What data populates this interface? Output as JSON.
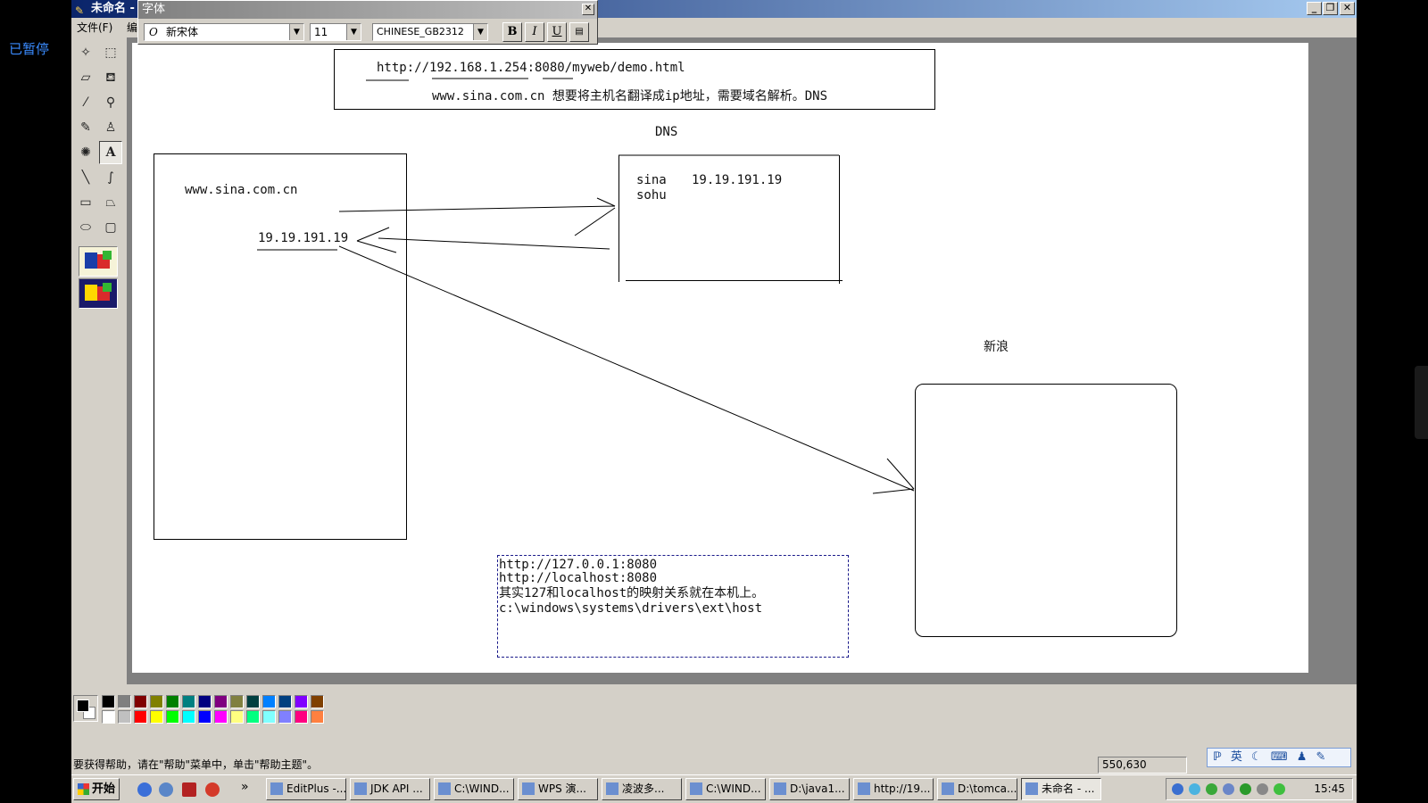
{
  "overlay": {
    "paused_label": "已暂停"
  },
  "window": {
    "title": "未命名 -",
    "min": "_",
    "max": "❐",
    "close": "✕"
  },
  "menu": {
    "file": "文件(F)",
    "edit": "编"
  },
  "font_toolbar": {
    "title": "字体",
    "close": "✕",
    "font_name": "新宋体",
    "font_size": "11",
    "charset": "CHINESE_GB2312",
    "bold": "B",
    "italic": "I",
    "underline": "U"
  },
  "tools": [
    "free-select",
    "rect-select",
    "eraser",
    "fill-bucket",
    "color-picker",
    "magnifier",
    "pencil",
    "brush",
    "airbrush",
    "text",
    "line",
    "curve",
    "rectangle",
    "polygon",
    "ellipse",
    "rounded-rectangle"
  ],
  "canvas": {
    "top_box": {
      "line1": "http://192.168.1.254:8080/myweb/demo.html",
      "line2": "www.sina.com.cn 想要将主机名翻译成ip地址，需要域名解析。DNS"
    },
    "dns_label": "DNS",
    "dns_box": {
      "row1_name": "sina",
      "row1_ip": "19.19.191.19",
      "row2_name": "sohu"
    },
    "client_box": {
      "domain": "www.sina.com.cn",
      "ip": "19.19.191.19"
    },
    "sina_label": "新浪",
    "text_box": {
      "line1": "http://127.0.0.1:8080",
      "line2": "http://localhost:8080",
      "line3": "其实127和localhost的映射关系就在本机上。",
      "line4": "c:\\windows\\systems\\drivers\\ext\\host"
    }
  },
  "palette": {
    "foreground": "#000000",
    "background": "#ffffff",
    "colors_top": [
      "#000000",
      "#808080",
      "#800000",
      "#808000",
      "#008000",
      "#008080",
      "#000080",
      "#800080",
      "#808040",
      "#004040",
      "#0080ff",
      "#004080",
      "#8000ff",
      "#804000"
    ],
    "colors_bottom": [
      "#ffffff",
      "#c0c0c0",
      "#ff0000",
      "#ffff00",
      "#00ff00",
      "#00ffff",
      "#0000ff",
      "#ff00ff",
      "#ffff80",
      "#00ff80",
      "#80ffff",
      "#8080ff",
      "#ff0080",
      "#ff8040"
    ]
  },
  "status": {
    "help": "要获得帮助，请在\"帮助\"菜单中，单击\"帮助主题\"。",
    "coords": "550,630"
  },
  "ime": {
    "mode": "英"
  },
  "taskbar": {
    "start": "开始",
    "chevron": "»",
    "tasks": [
      "EditPlus -...",
      "JDK API ...",
      "C:\\WIND...",
      "WPS 演...",
      "凌波多...",
      "C:\\WIND...",
      "D:\\java1...",
      "http://19...",
      "D:\\tomca...",
      "未命名 - ..."
    ],
    "clock": "15:45"
  }
}
